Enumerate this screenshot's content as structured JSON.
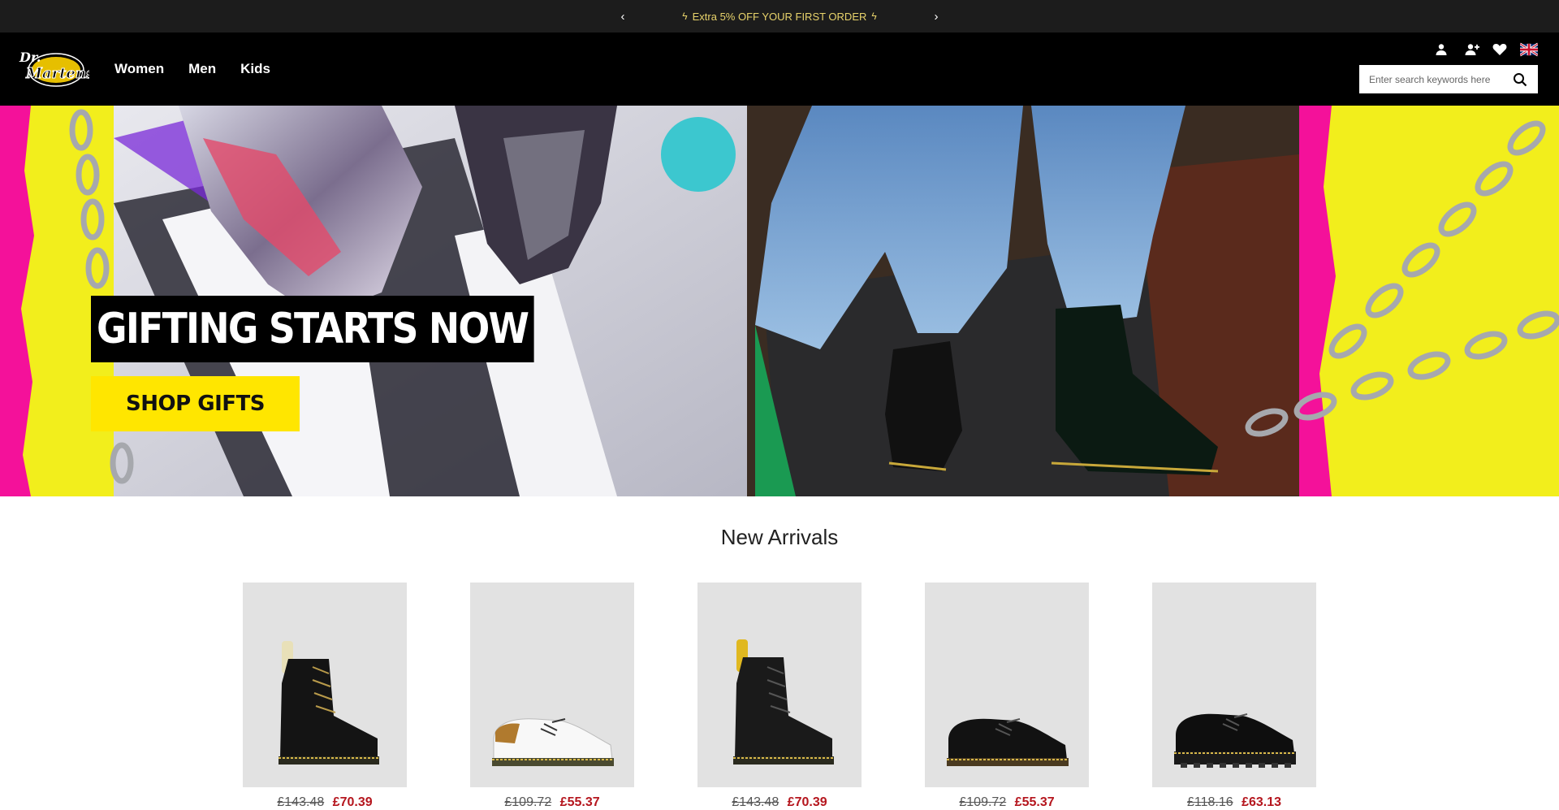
{
  "promo": {
    "message": "Extra 5% OFF YOUR FIRST ORDER",
    "prev_label": "‹",
    "next_label": "›"
  },
  "header": {
    "brand": "Dr. Martens",
    "nav": [
      "Women",
      "Men",
      "Kids"
    ],
    "search_placeholder": "Enter search keywords here",
    "icons": [
      "account-icon",
      "add-user-icon",
      "heart-icon",
      "uk-flag-icon",
      "search-icon"
    ]
  },
  "hero": {
    "headline": "GIFTING STARTS NOW",
    "cta": "SHOP GIFTS"
  },
  "arrivals": {
    "title": "New Arrivals",
    "products": [
      {
        "old_price": "£143.48",
        "new_price": "£70.39",
        "style": "boot-8eye-cream"
      },
      {
        "old_price": "£109.72",
        "new_price": "£55.37",
        "style": "shoe-white"
      },
      {
        "old_price": "£143.48",
        "new_price": "£70.39",
        "style": "boot-8eye-yellow"
      },
      {
        "old_price": "£109.72",
        "new_price": "£55.37",
        "style": "shoe-black"
      },
      {
        "old_price": "£118.16",
        "new_price": "£63.13",
        "style": "shoe-black-chunky"
      }
    ]
  },
  "colors": {
    "promo_bg": "#1c1c1c",
    "promo_text": "#e8d36b",
    "header_bg": "#000000",
    "cta_yellow": "#ffe600",
    "sale_red": "#b5161e"
  }
}
